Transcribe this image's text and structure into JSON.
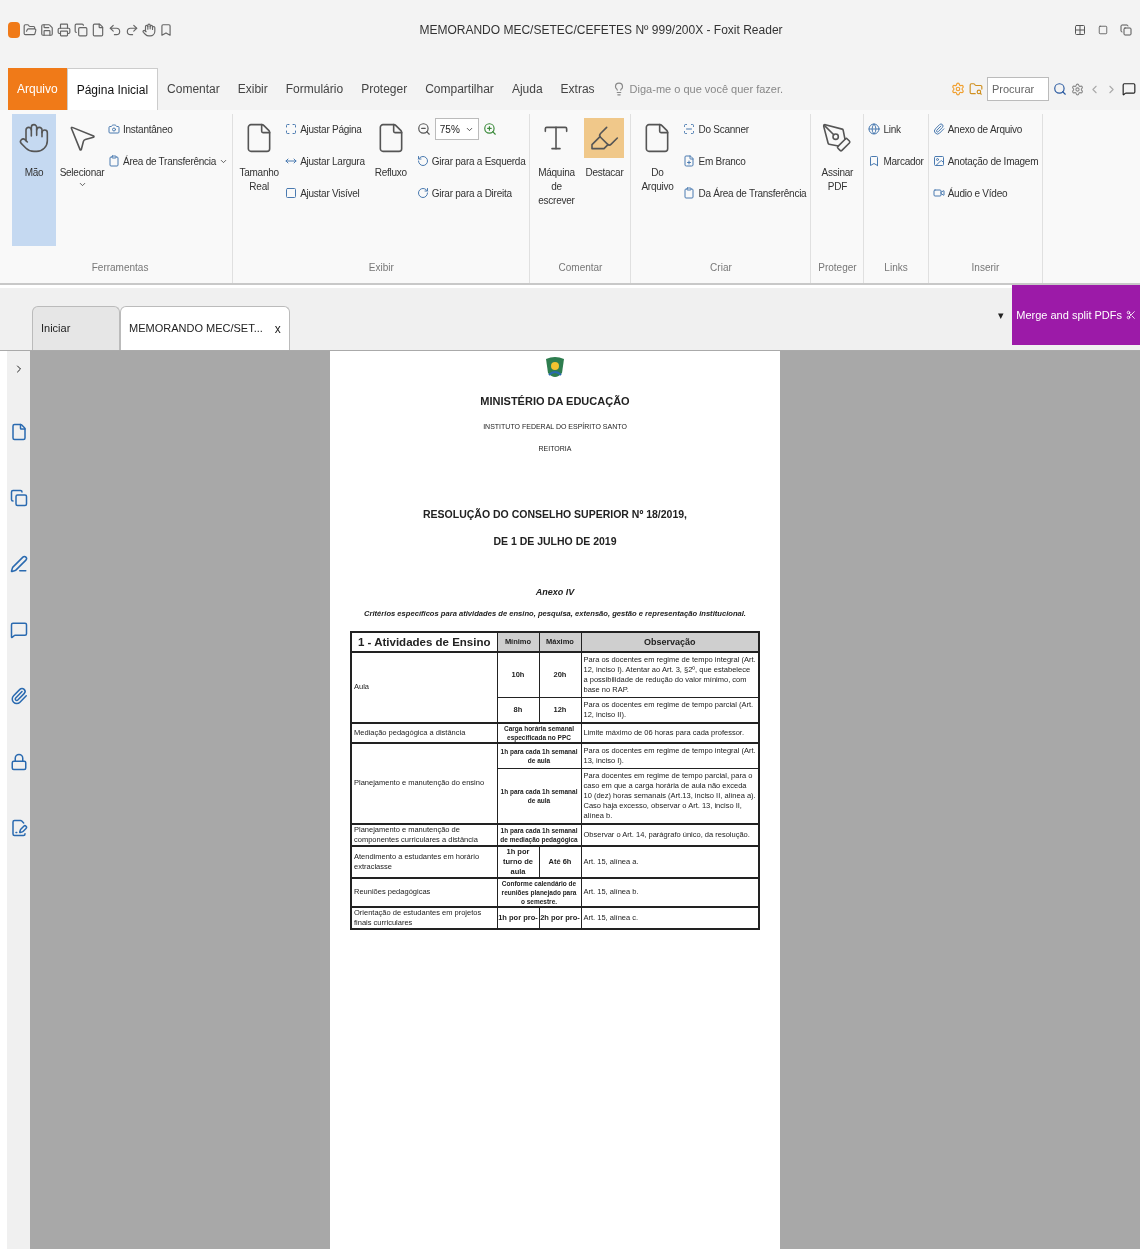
{
  "window": {
    "title": "MEMORANDO MEC/SETEC/CEFETES Nº 999/200X - Foxit Reader"
  },
  "menu": [
    {
      "label": "Arquivo",
      "kind": "file",
      "selected": false
    },
    {
      "label": "Página Inicial",
      "kind": "tab",
      "selected": true
    },
    {
      "label": "Comentar",
      "kind": "tab",
      "selected": false
    },
    {
      "label": "Exibir",
      "kind": "tab",
      "selected": false
    },
    {
      "label": "Formulário",
      "kind": "tab",
      "selected": false
    },
    {
      "label": "Proteger",
      "kind": "tab",
      "selected": false
    },
    {
      "label": "Compartilhar",
      "kind": "tab",
      "selected": false
    },
    {
      "label": "Ajuda",
      "kind": "tab",
      "selected": false
    },
    {
      "label": "Extras",
      "kind": "tab",
      "selected": false
    }
  ],
  "tell_me": {
    "placeholder": "Diga-me o que você quer fazer."
  },
  "search": {
    "placeholder": "Procurar"
  },
  "ribbon": [
    {
      "label": "Ferramentas",
      "items": [
        {
          "kind": "large",
          "label": "Mão",
          "selected": true
        },
        {
          "kind": "large",
          "label": "Selecionar",
          "selected": false,
          "dropdown": true
        },
        {
          "kind": "column",
          "items": [
            {
              "kind": "small",
              "label": "Instantâneo"
            },
            {
              "kind": "small",
              "label": "Área de Transferência",
              "dropdown": true
            }
          ]
        }
      ]
    },
    {
      "label": "Exibir",
      "items": [
        {
          "kind": "large",
          "label": "Tamanho Real",
          "selected": false
        },
        {
          "kind": "column",
          "items": [
            {
              "kind": "small",
              "label": "Ajustar Página"
            },
            {
              "kind": "small",
              "label": "Ajustar Largura"
            },
            {
              "kind": "small",
              "label": "Ajustar Visível"
            }
          ]
        },
        {
          "kind": "large",
          "label": "Refluxo",
          "selected": false
        },
        {
          "kind": "column",
          "items": [
            {
              "kind": "zoom",
              "label": "75%"
            },
            {
              "kind": "small",
              "label": "Girar para a Esquerda"
            },
            {
              "kind": "small",
              "label": "Girar para a Direita"
            }
          ]
        }
      ]
    },
    {
      "label": "Comentar",
      "items": [
        {
          "kind": "large",
          "label": "Máquina de escrever",
          "selected": false
        },
        {
          "kind": "large",
          "label": "Destacar",
          "selected": false
        }
      ]
    },
    {
      "label": "Criar",
      "items": [
        {
          "kind": "large",
          "label": "Do Arquivo",
          "selected": false
        },
        {
          "kind": "column",
          "items": [
            {
              "kind": "small",
              "label": "Do Scanner"
            },
            {
              "kind": "small",
              "label": "Em Branco"
            },
            {
              "kind": "small",
              "label": "Da Área de Transferência"
            }
          ]
        }
      ]
    },
    {
      "label": "Proteger",
      "items": [
        {
          "kind": "large",
          "label": "Assinar PDF",
          "selected": false
        }
      ]
    },
    {
      "label": "Links",
      "items": [
        {
          "kind": "column",
          "items": [
            {
              "kind": "small",
              "label": "Link"
            },
            {
              "kind": "small",
              "label": "Marcador"
            }
          ]
        }
      ]
    },
    {
      "label": "Inserir",
      "items": [
        {
          "kind": "column",
          "items": [
            {
              "kind": "small",
              "label": "Anexo de Arquivo"
            },
            {
              "kind": "small",
              "label": "Anotação de Imagem"
            },
            {
              "kind": "small",
              "label": "Áudio e Vídeo"
            }
          ]
        }
      ]
    }
  ],
  "doc_tabs": [
    {
      "label": "Iniciar",
      "selected": false
    },
    {
      "label": "MEMORANDO MEC/SET...",
      "selected": true,
      "close": "x"
    }
  ],
  "tab_menu": "▾",
  "promo_button": "Merge and split PDFs",
  "document": {
    "header": [
      "MINISTÉRIO DA EDUCAÇÃO",
      "INSTITUTO FEDERAL DO ESPÍRITO SANTO",
      "REITORIA"
    ],
    "title": [
      "RESOLUÇÃO DO CONSELHO SUPERIOR Nº 18/2019,",
      "DE 1 DE JULHO DE 2019"
    ],
    "annex": "Anexo IV",
    "subtitle": "Critérios específicos para atividades de ensino, pesquisa, extensão, gestão e representação institucional.",
    "table": {
      "columns": [
        "1 - Atividades de Ensino",
        "Mínimo",
        "Máximo",
        "Observação"
      ],
      "rows": [
        {
          "activity": "Aula",
          "sub": [
            {
              "kind": "split",
              "min": "10h",
              "max": "20h",
              "obs": "Para os docentes em regime de tempo integral (Art. 12, inciso I). Atentar ao Art. 3, §2º, que estabelece a possibilidade de redução do valor mínimo, com base no RAP."
            },
            {
              "kind": "split",
              "min": "8h",
              "max": "12h",
              "obs": "Para os docentes em regime de tempo parcial (Art. 12, inciso II)."
            }
          ]
        },
        {
          "activity": "Mediação pedagógica a distância",
          "sub": [
            {
              "kind": "merged",
              "value": "Carga horária semanal especificada no PPC",
              "obs": "Limite máximo de 06 horas para cada professor."
            }
          ]
        },
        {
          "activity": "Planejamento e manutenção do ensino",
          "sub": [
            {
              "kind": "merged",
              "value": "1h para cada 1h semanal de aula",
              "obs": "Para os docentes em regime de tempo integral (Art. 13, inciso I)."
            },
            {
              "kind": "merged",
              "value": "1h para cada 1h semanal de aula",
              "obs": "Para docentes em regime de tempo parcial, para o caso em que a carga horária de aula não exceda 10 (dez) horas semanais (Art.13, inciso II, alínea a). Caso haja excesso, observar o Art. 13, inciso II, alínea b."
            }
          ]
        },
        {
          "activity": "Planejamento e manutenção de componentes curriculares a distância",
          "sub": [
            {
              "kind": "merged",
              "value": "1h para cada 1h semanal de mediação pedagógica",
              "obs": "Observar o Art. 14, parágrafo único, da resolução."
            }
          ]
        },
        {
          "activity": "Atendimento a estudantes em horário extraclasse",
          "sub": [
            {
              "kind": "split",
              "min": "1h por turno de aula",
              "max": "Até 6h",
              "obs": "Art. 15, alínea a."
            }
          ]
        },
        {
          "activity": "Reuniões pedagógicas",
          "sub": [
            {
              "kind": "merged",
              "value": "Conforme calendário de reuniões planejado para o semestre.",
              "obs": "Art. 15, alínea b."
            }
          ]
        },
        {
          "activity": "Orientação de estudantes em projetos finais curriculares",
          "sub": [
            {
              "kind": "split",
              "min": "1h por pro-",
              "max": "2h por pro-",
              "obs": "Art. 15, alínea c."
            }
          ]
        }
      ]
    }
  }
}
